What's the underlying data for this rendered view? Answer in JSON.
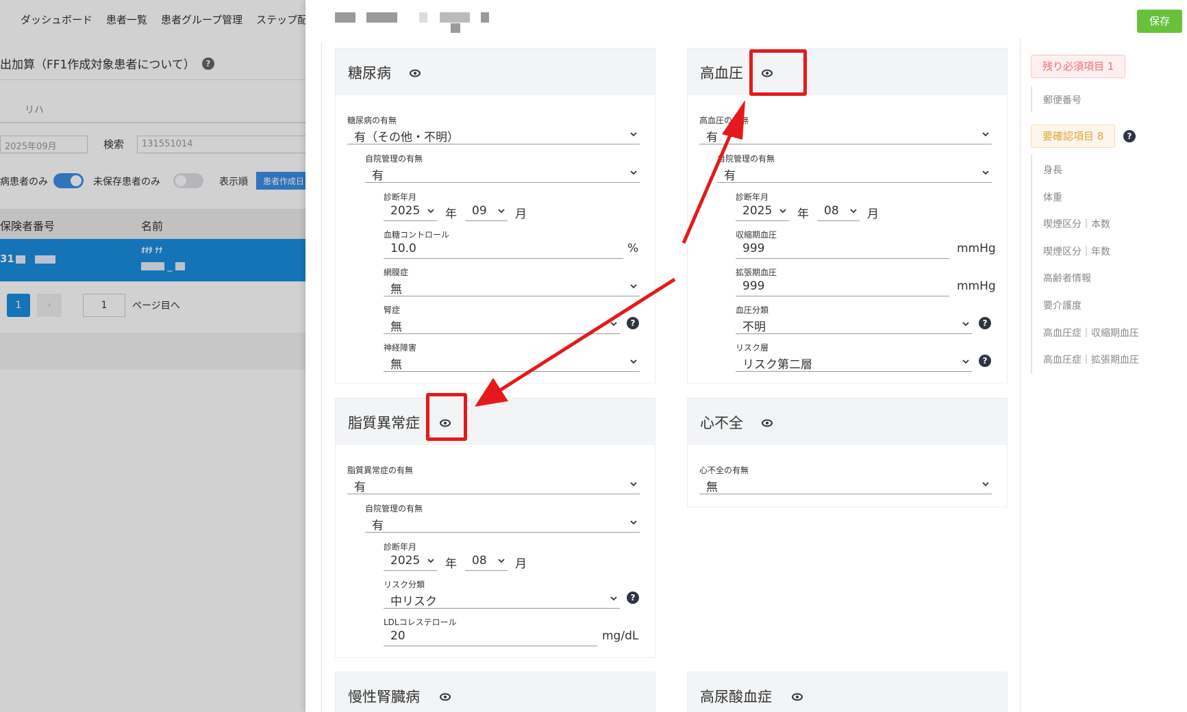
{
  "background_app": {
    "nav": [
      "ダッシュボード",
      "患者一覧",
      "患者グループ管理",
      "ステップ配"
    ],
    "page_title": "出加算（FF1作成対象患者について）",
    "tab": "リハ",
    "month_value": "2025年09月",
    "search_label": "検索",
    "search_value": "131551014",
    "toggle1_label": "病患者のみ",
    "toggle2_label": "未保存患者のみ",
    "sort_label": "表示順",
    "sort_value": "患者作成日",
    "table_headers": [
      "保険者番号",
      "名前"
    ],
    "row_prefix": "31",
    "row_kana": "ｵｵﾀ ﾅﾅ",
    "row_name_sep": "_",
    "page_current": "1",
    "page_next": "›",
    "page_input": "1",
    "page_goto": "ページ目へ"
  },
  "header": {
    "save_label": "保存"
  },
  "cards": {
    "diabetes": {
      "title": "糖尿病",
      "presence_label": "糖尿病の有無",
      "presence_value": "有（その他・不明）",
      "self_label": "自院管理の有無",
      "self_value": "有",
      "diag_label": "診断年月",
      "year": "2025",
      "year_unit": "年",
      "month": "09",
      "month_unit": "月",
      "glucose_label": "血糖コントロール",
      "glucose_value": "10.0",
      "glucose_unit": "%",
      "retino_label": "網膜症",
      "retino_value": "無",
      "kidney_label": "腎症",
      "kidney_value": "無",
      "neuro_label": "神経障害",
      "neuro_value": "無"
    },
    "hypertension": {
      "title": "高血圧",
      "presence_label": "高血圧の有無",
      "presence_value": "有",
      "self_label": "自院管理の有無",
      "self_value": "有",
      "diag_label": "診断年月",
      "year": "2025",
      "year_unit": "年",
      "month": "08",
      "month_unit": "月",
      "sys_label": "収縮期血圧",
      "sys_value": "999",
      "sys_unit": "mmHg",
      "dia_label": "拡張期血圧",
      "dia_value": "999",
      "dia_unit": "mmHg",
      "class_label": "血圧分類",
      "class_value": "不明",
      "risk_label": "リスク層",
      "risk_value": "リスク第二層"
    },
    "dyslipidemia": {
      "title": "脂質異常症",
      "presence_label": "脂質異常症の有無",
      "presence_value": "有",
      "self_label": "自院管理の有無",
      "self_value": "有",
      "diag_label": "診断年月",
      "year": "2025",
      "year_unit": "年",
      "month": "08",
      "month_unit": "月",
      "risk_label": "リスク分類",
      "risk_value": "中リスク",
      "ldl_label": "LDLコレステロール",
      "ldl_value": "20",
      "ldl_unit": "mg/dL"
    },
    "heart_failure": {
      "title": "心不全",
      "presence_label": "心不全の有無",
      "presence_value": "無"
    },
    "ckd": {
      "title": "慢性腎臓病"
    },
    "hyperuricemia": {
      "title": "高尿酸血症"
    }
  },
  "sidebar": {
    "required_badge": "残り必須項目 1",
    "required_items": [
      "郵便番号"
    ],
    "confirm_badge": "要確認項目 8",
    "confirm_items": [
      "身長",
      "体重",
      "喫煙区分｜本数",
      "喫煙区分｜年数",
      "高齢者情報",
      "要介護度",
      "高血圧症｜収縮期血圧",
      "高血圧症｜拡張期血圧"
    ]
  },
  "help_glyph": "?",
  "colors": {
    "save": "#67c23a",
    "highlight": "#e5191b",
    "required_badge": "#f56c6c",
    "confirm_badge": "#e6a23c",
    "selected_row": "#1a8de0"
  }
}
